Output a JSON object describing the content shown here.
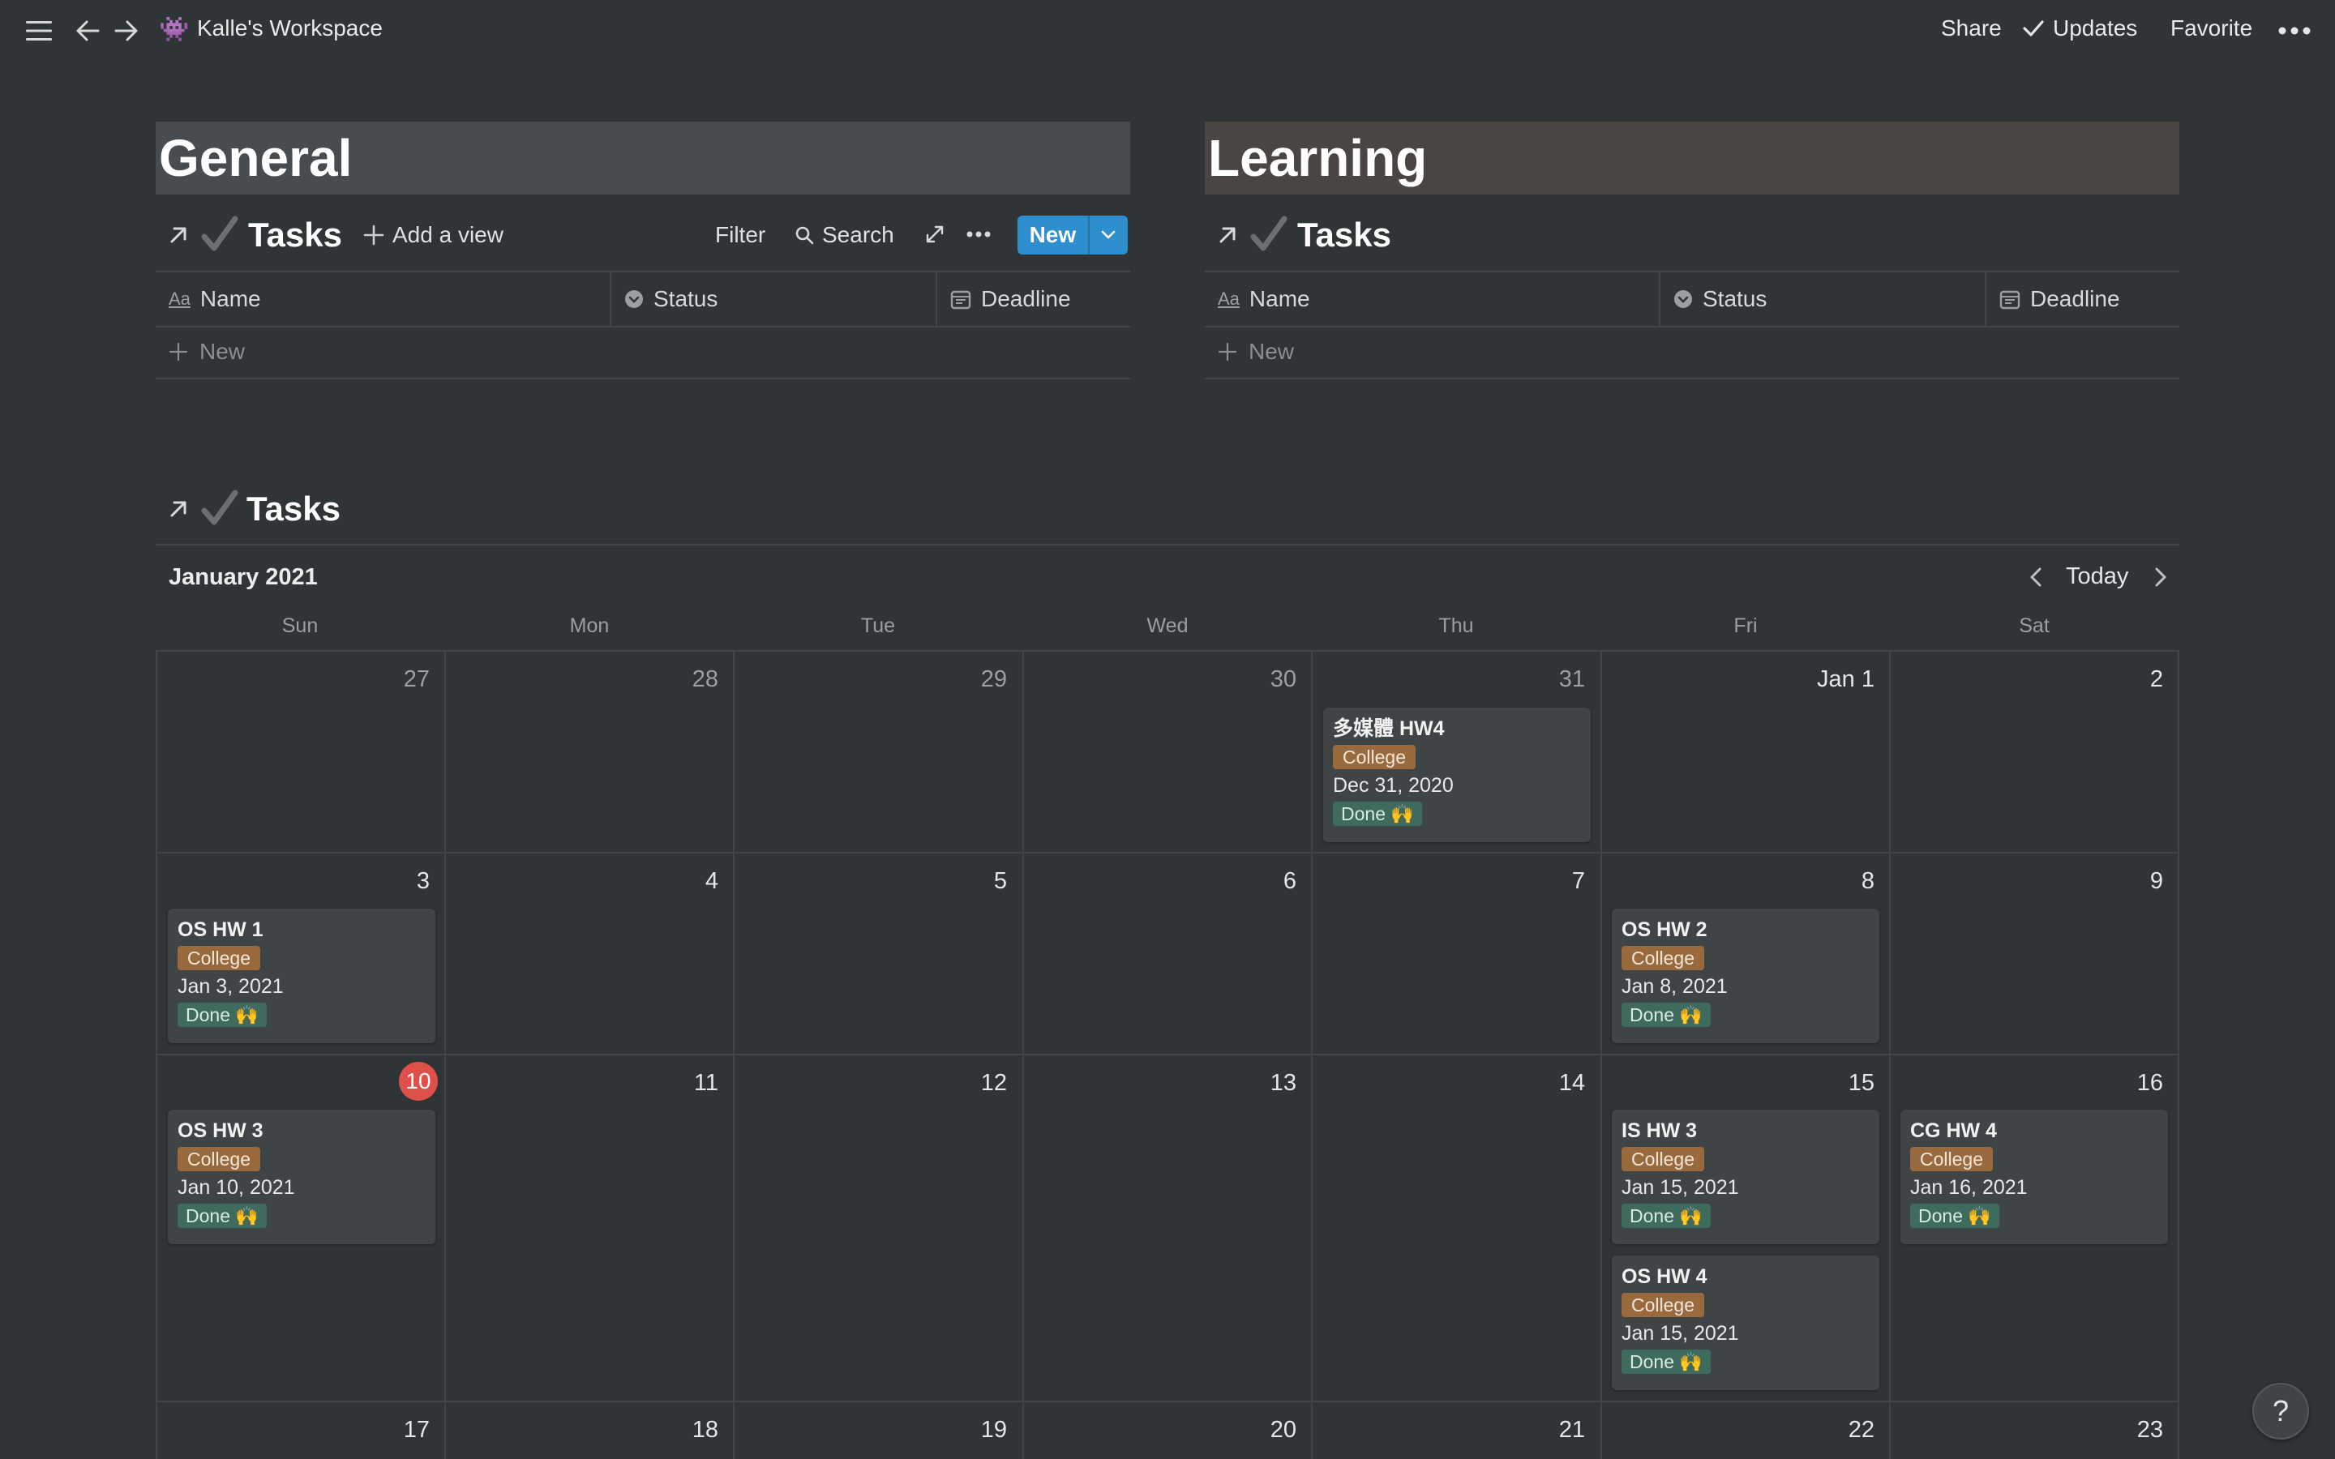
{
  "topbar": {
    "workspace_emoji": "👾",
    "workspace_title": "Kalle's Workspace",
    "share": "Share",
    "updates": "Updates",
    "favorite": "Favorite"
  },
  "pages": {
    "general": {
      "title": "General",
      "db_title": "Tasks"
    },
    "learning": {
      "title": "Learning",
      "db_title": "Tasks"
    }
  },
  "toolbar": {
    "add_view": "Add a view",
    "filter": "Filter",
    "search": "Search",
    "new": "New"
  },
  "table": {
    "columns": [
      "Name",
      "Status",
      "Deadline"
    ],
    "new_row": "New"
  },
  "calendar": {
    "db_title": "Tasks",
    "month": "January 2021",
    "today": "Today",
    "weekdays": [
      "Sun",
      "Mon",
      "Tue",
      "Wed",
      "Thu",
      "Fri",
      "Sat"
    ],
    "weeks": [
      [
        "27",
        "28",
        "29",
        "30",
        "31",
        "Jan 1",
        "2"
      ],
      [
        "3",
        "4",
        "5",
        "6",
        "7",
        "8",
        "9"
      ],
      [
        "10",
        "11",
        "12",
        "13",
        "14",
        "15",
        "16"
      ],
      [
        "17",
        "18",
        "19",
        "20",
        "21",
        "22",
        "23"
      ]
    ],
    "today_day": "10",
    "tag_college": "College",
    "status_done": "Done 🙌",
    "cards": [
      {
        "title": "多媒體 HW4",
        "date": "Dec 31, 2020"
      },
      {
        "title": "OS HW 1",
        "date": "Jan 3, 2021"
      },
      {
        "title": "OS HW 2",
        "date": "Jan 8, 2021"
      },
      {
        "title": "OS HW 3",
        "date": "Jan 10, 2021"
      },
      {
        "title": "IS HW 3",
        "date": "Jan 15, 2021"
      },
      {
        "title": "OS HW 4",
        "date": "Jan 15, 2021"
      },
      {
        "title": "CG HW 4",
        "date": "Jan 16, 2021"
      }
    ]
  },
  "help": "?",
  "colors": {
    "background": "#2f3437",
    "accent_blue": "#2e8fce",
    "today_red": "#e0504a",
    "tag_college": "#9a6a3f",
    "tag_done": "#3f6b5e"
  }
}
